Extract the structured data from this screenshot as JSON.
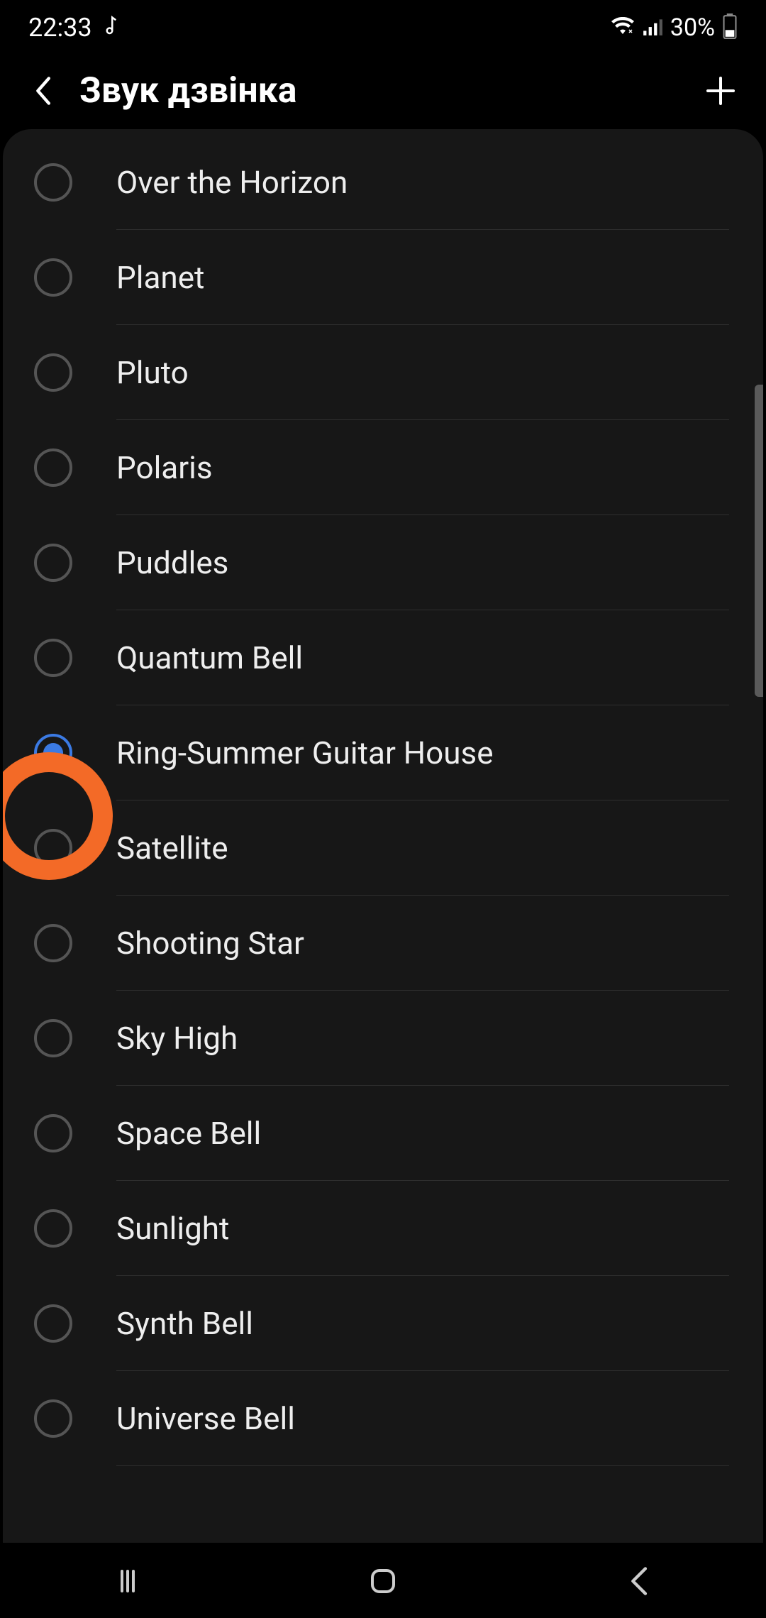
{
  "status": {
    "time": "22:33",
    "battery_text": "30%"
  },
  "header": {
    "title": "Звук дзвінка"
  },
  "ringtones": [
    {
      "label": "Over the Horizon",
      "selected": false
    },
    {
      "label": "Planet",
      "selected": false
    },
    {
      "label": "Pluto",
      "selected": false
    },
    {
      "label": "Polaris",
      "selected": false
    },
    {
      "label": "Puddles",
      "selected": false
    },
    {
      "label": "Quantum Bell",
      "selected": false
    },
    {
      "label": "Ring-Summer Guitar House",
      "selected": true
    },
    {
      "label": "Satellite",
      "selected": false
    },
    {
      "label": "Shooting Star",
      "selected": false
    },
    {
      "label": "Sky High",
      "selected": false
    },
    {
      "label": "Space Bell",
      "selected": false
    },
    {
      "label": "Sunlight",
      "selected": false
    },
    {
      "label": "Synth Bell",
      "selected": false
    },
    {
      "label": "Universe Bell",
      "selected": false
    }
  ]
}
